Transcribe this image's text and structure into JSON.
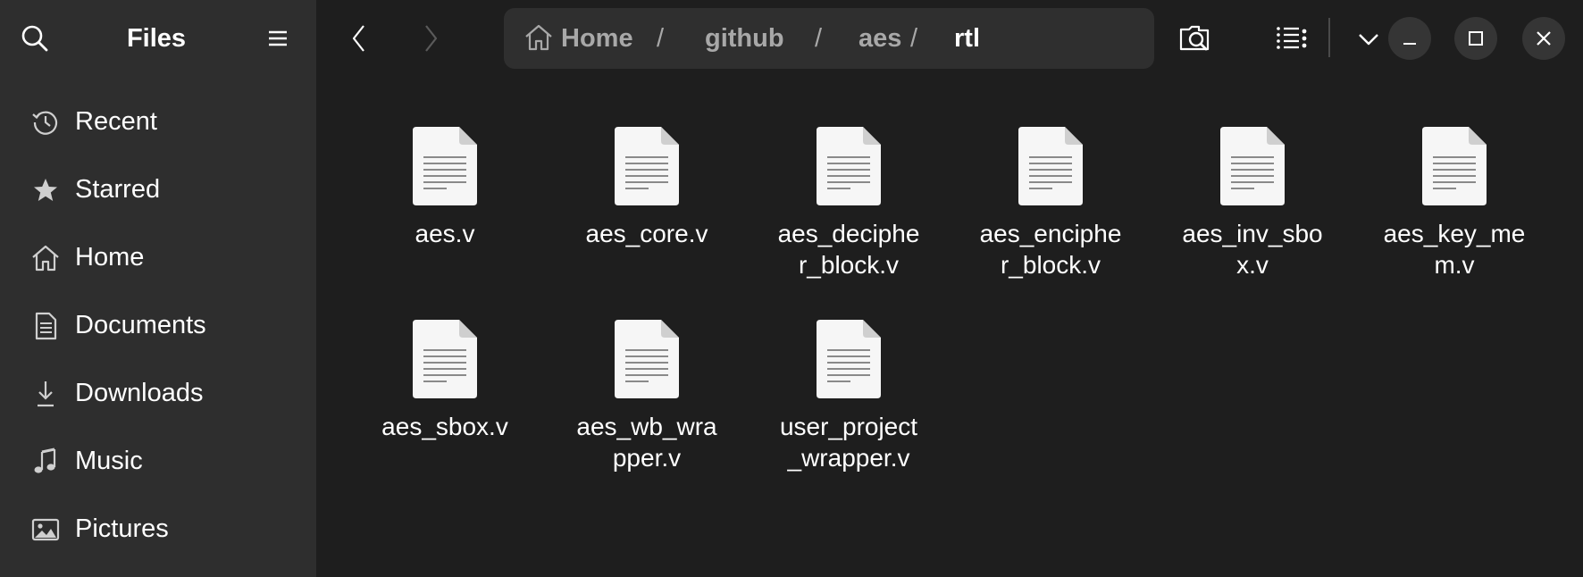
{
  "sidebar": {
    "title": "Files",
    "search_icon": "search-icon",
    "menu_icon": "hamburger-menu-icon",
    "items": [
      {
        "label": "Recent",
        "icon": "clock-history-icon"
      },
      {
        "label": "Starred",
        "icon": "star-icon"
      },
      {
        "label": "Home",
        "icon": "home-icon"
      },
      {
        "label": "Documents",
        "icon": "document-icon"
      },
      {
        "label": "Downloads",
        "icon": "download-icon"
      },
      {
        "label": "Music",
        "icon": "music-note-icon"
      },
      {
        "label": "Pictures",
        "icon": "picture-icon"
      }
    ]
  },
  "toolbar": {
    "back_icon": "chevron-left-icon",
    "forward_icon": "chevron-right-icon",
    "breadcrumbs": [
      "Home",
      "github",
      "aes",
      "rtl"
    ],
    "separator": "/",
    "path_menu_icon": "vertical-dots-icon",
    "search_icon": "folder-search-icon",
    "view_icon": "list-view-icon",
    "view_dropdown_icon": "chevron-down-icon"
  },
  "window_controls": {
    "minimize_icon": "minimize-icon",
    "maximize_icon": "maximize-icon",
    "close_icon": "close-icon"
  },
  "files": [
    {
      "lines": [
        "aes.v"
      ]
    },
    {
      "lines": [
        "aes_core.v"
      ]
    },
    {
      "lines": [
        "aes_deciphe",
        "r_block.v"
      ]
    },
    {
      "lines": [
        "aes_enciphe",
        "r_block.v"
      ]
    },
    {
      "lines": [
        "aes_inv_sbo",
        "x.v"
      ]
    },
    {
      "lines": [
        "aes_key_me",
        "m.v"
      ]
    },
    {
      "lines": [
        "aes_sbox.v"
      ]
    },
    {
      "lines": [
        "aes_wb_wra",
        "pper.v"
      ]
    },
    {
      "lines": [
        "user_project",
        "_wrapper.v"
      ]
    }
  ],
  "colors": {
    "sidebar_bg": "#2e2e2e",
    "main_bg": "#1e1e1e",
    "pathbar_bg": "#2f2f2f",
    "window_button_bg": "#353535",
    "text": "#ffffff",
    "muted_text": "#a8a8a8"
  }
}
